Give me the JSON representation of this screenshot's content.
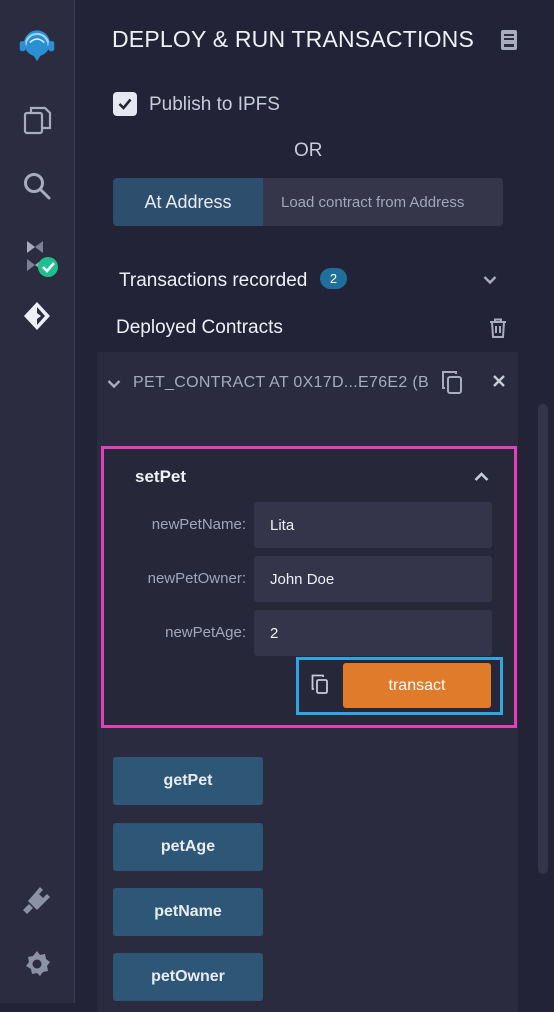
{
  "header": {
    "title": "DEPLOY & RUN TRANSACTIONS"
  },
  "publish": {
    "label": "Publish to IPFS",
    "checked": true
  },
  "or_label": "OR",
  "at_address": {
    "button": "At Address",
    "placeholder": "Load contract from Address"
  },
  "transactions": {
    "label": "Transactions recorded",
    "count": "2"
  },
  "deployed": {
    "label": "Deployed Contracts"
  },
  "contract": {
    "name": "PET_CONTRACT AT 0X17D...E76E2 (B",
    "functions": {
      "setPet": {
        "title": "setPet",
        "params": [
          {
            "label": "newPetName:",
            "value": "Lita"
          },
          {
            "label": "newPetOwner:",
            "value": "John Doe"
          },
          {
            "label": "newPetAge:",
            "value": "2"
          }
        ],
        "action": "transact"
      }
    },
    "calls": [
      "getPet",
      "petAge",
      "petName",
      "petOwner"
    ]
  },
  "colors": {
    "accent_pink": "#e53fb7",
    "accent_blue": "#30a5e0",
    "transact_orange": "#e07b2b",
    "call_button": "#2e5677",
    "verified_green": "#1fbf8f"
  },
  "icons": [
    "remix-logo-icon",
    "file-explorer-icon",
    "search-icon",
    "solidity-compiler-icon",
    "deploy-run-icon",
    "plugin-manager-icon",
    "settings-icon",
    "documentation-icon",
    "trash-icon",
    "chevron-down-icon",
    "copy-icon",
    "close-icon",
    "chevron-up-icon"
  ]
}
